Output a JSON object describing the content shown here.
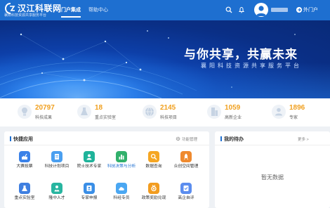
{
  "header": {
    "logo_title": "汉江科联网",
    "logo_subtitle": "襄阳科技资源共享服务平台",
    "nav": [
      {
        "label": "门户集成",
        "active": true
      },
      {
        "label": "帮助中心",
        "active": false
      }
    ],
    "exit_label": "外门户",
    "accent_color": "#1e6fd0"
  },
  "banner": {
    "headline": "与你共享，共赢未来",
    "subheadline": "襄阳科技资源共享服务平台"
  },
  "stats": [
    {
      "value": "20797",
      "label": "科技成果",
      "icon": "lightbulb-icon"
    },
    {
      "value": "18",
      "label": "重点实验室",
      "icon": "flask-icon"
    },
    {
      "value": "2145",
      "label": "科技项目",
      "icon": "globe-icon"
    },
    {
      "value": "1059",
      "label": "高新企业",
      "icon": "building-icon"
    },
    {
      "value": "1896",
      "label": "专家",
      "icon": "person-icon"
    }
  ],
  "quick_apps": {
    "title": "快捷应用",
    "manage_label": "功能管理",
    "items": [
      {
        "label": "大赛投票",
        "icon": "vote-icon",
        "color": "#3b82e8"
      },
      {
        "label": "科技计划项目",
        "icon": "document-icon",
        "color": "#4a9ff0"
      },
      {
        "label": "院士技术专家",
        "icon": "expert-icon",
        "color": "#1fb39a"
      },
      {
        "label": "科技决策与分析",
        "icon": "bar-chart-icon",
        "color": "#31b06b",
        "highlight": true
      },
      {
        "label": "数据查询",
        "icon": "search-data-icon",
        "color": "#f5a623"
      },
      {
        "label": "众创空间管理",
        "icon": "rocket-icon",
        "color": "#ef8a2f"
      },
      {
        "label": "重点实验室",
        "icon": "lab-icon",
        "color": "#3f7fe0"
      },
      {
        "label": "隆中人才",
        "icon": "talent-icon",
        "color": "#28b5a0"
      },
      {
        "label": "专家申报",
        "icon": "declare-icon",
        "color": "#3a8ee6"
      },
      {
        "label": "科经专员",
        "icon": "cloud-icon",
        "color": "#4aa7f2"
      },
      {
        "label": "政策奖励兑现",
        "icon": "medal-icon",
        "color": "#f29c1f"
      },
      {
        "label": "高企自评",
        "icon": "evaluate-icon",
        "color": "#5b8def"
      }
    ]
  },
  "todo": {
    "title": "我的待办",
    "more_label": "更多 >",
    "empty_text": "暂无数据"
  }
}
